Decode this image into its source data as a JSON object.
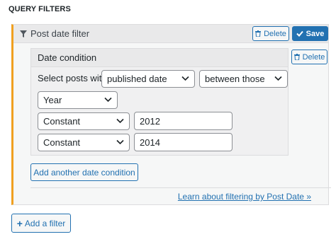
{
  "section_title": "QUERY FILTERS",
  "filter": {
    "title": "Post date filter",
    "delete_label": "Delete",
    "save_label": "Save"
  },
  "condition": {
    "title": "Date condition",
    "delete_label": "Delete",
    "select_posts_label": "Select posts with",
    "date_field": "published date",
    "comparison": "between those",
    "unit": "Year",
    "from_type": "Constant",
    "from_value": "2012",
    "to_type": "Constant",
    "to_value": "2014"
  },
  "add_condition_label": "Add another date condition",
  "learn_link": "Learn about filtering by Post Date »",
  "add_filter_label": "Add a filter",
  "colors": {
    "accent": "#2271b1",
    "panel_border_left": "#f0a020"
  }
}
